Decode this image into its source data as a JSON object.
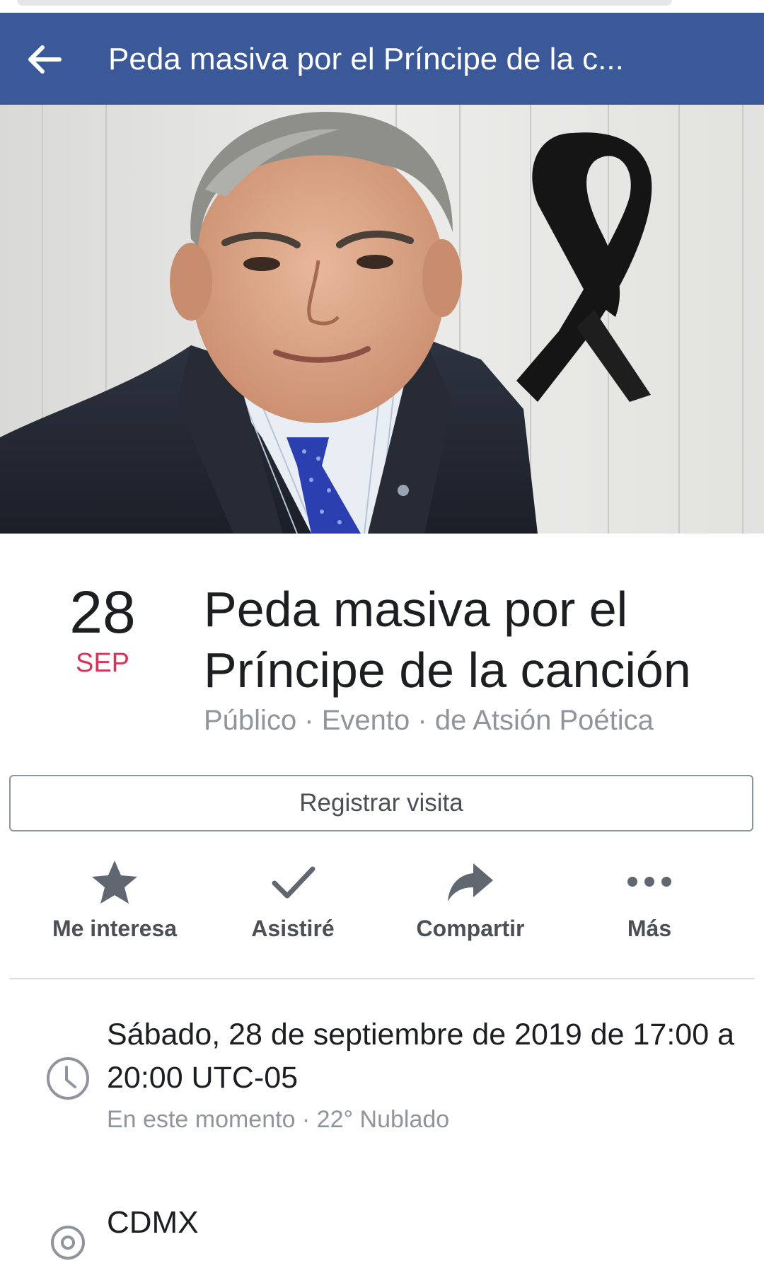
{
  "appbar": {
    "title": "Peda masiva por el Príncipe de la c...",
    "back_icon": "arrow-left-icon",
    "background": "#3b5998"
  },
  "event": {
    "day": "28",
    "month": "SEP",
    "title": "Peda masiva por el Príncipe de la canción",
    "meta": "Público · Evento · de Atsión Poética",
    "month_color": "#d6345a"
  },
  "register": {
    "label": "Registrar visita"
  },
  "actions": [
    {
      "icon": "star-icon",
      "label": "Me interesa"
    },
    {
      "icon": "check-icon",
      "label": "Asistiré"
    },
    {
      "icon": "share-icon",
      "label": "Compartir"
    },
    {
      "icon": "more-icon",
      "label": "Más"
    }
  ],
  "time": {
    "icon": "clock-icon",
    "main": "Sábado, 28 de septiembre de 2019 de 17:00 a 20:00 UTC-05",
    "sub": "En este momento · 22° Nublado"
  },
  "place": {
    "icon": "location-pin-icon",
    "name": "CDMX"
  }
}
